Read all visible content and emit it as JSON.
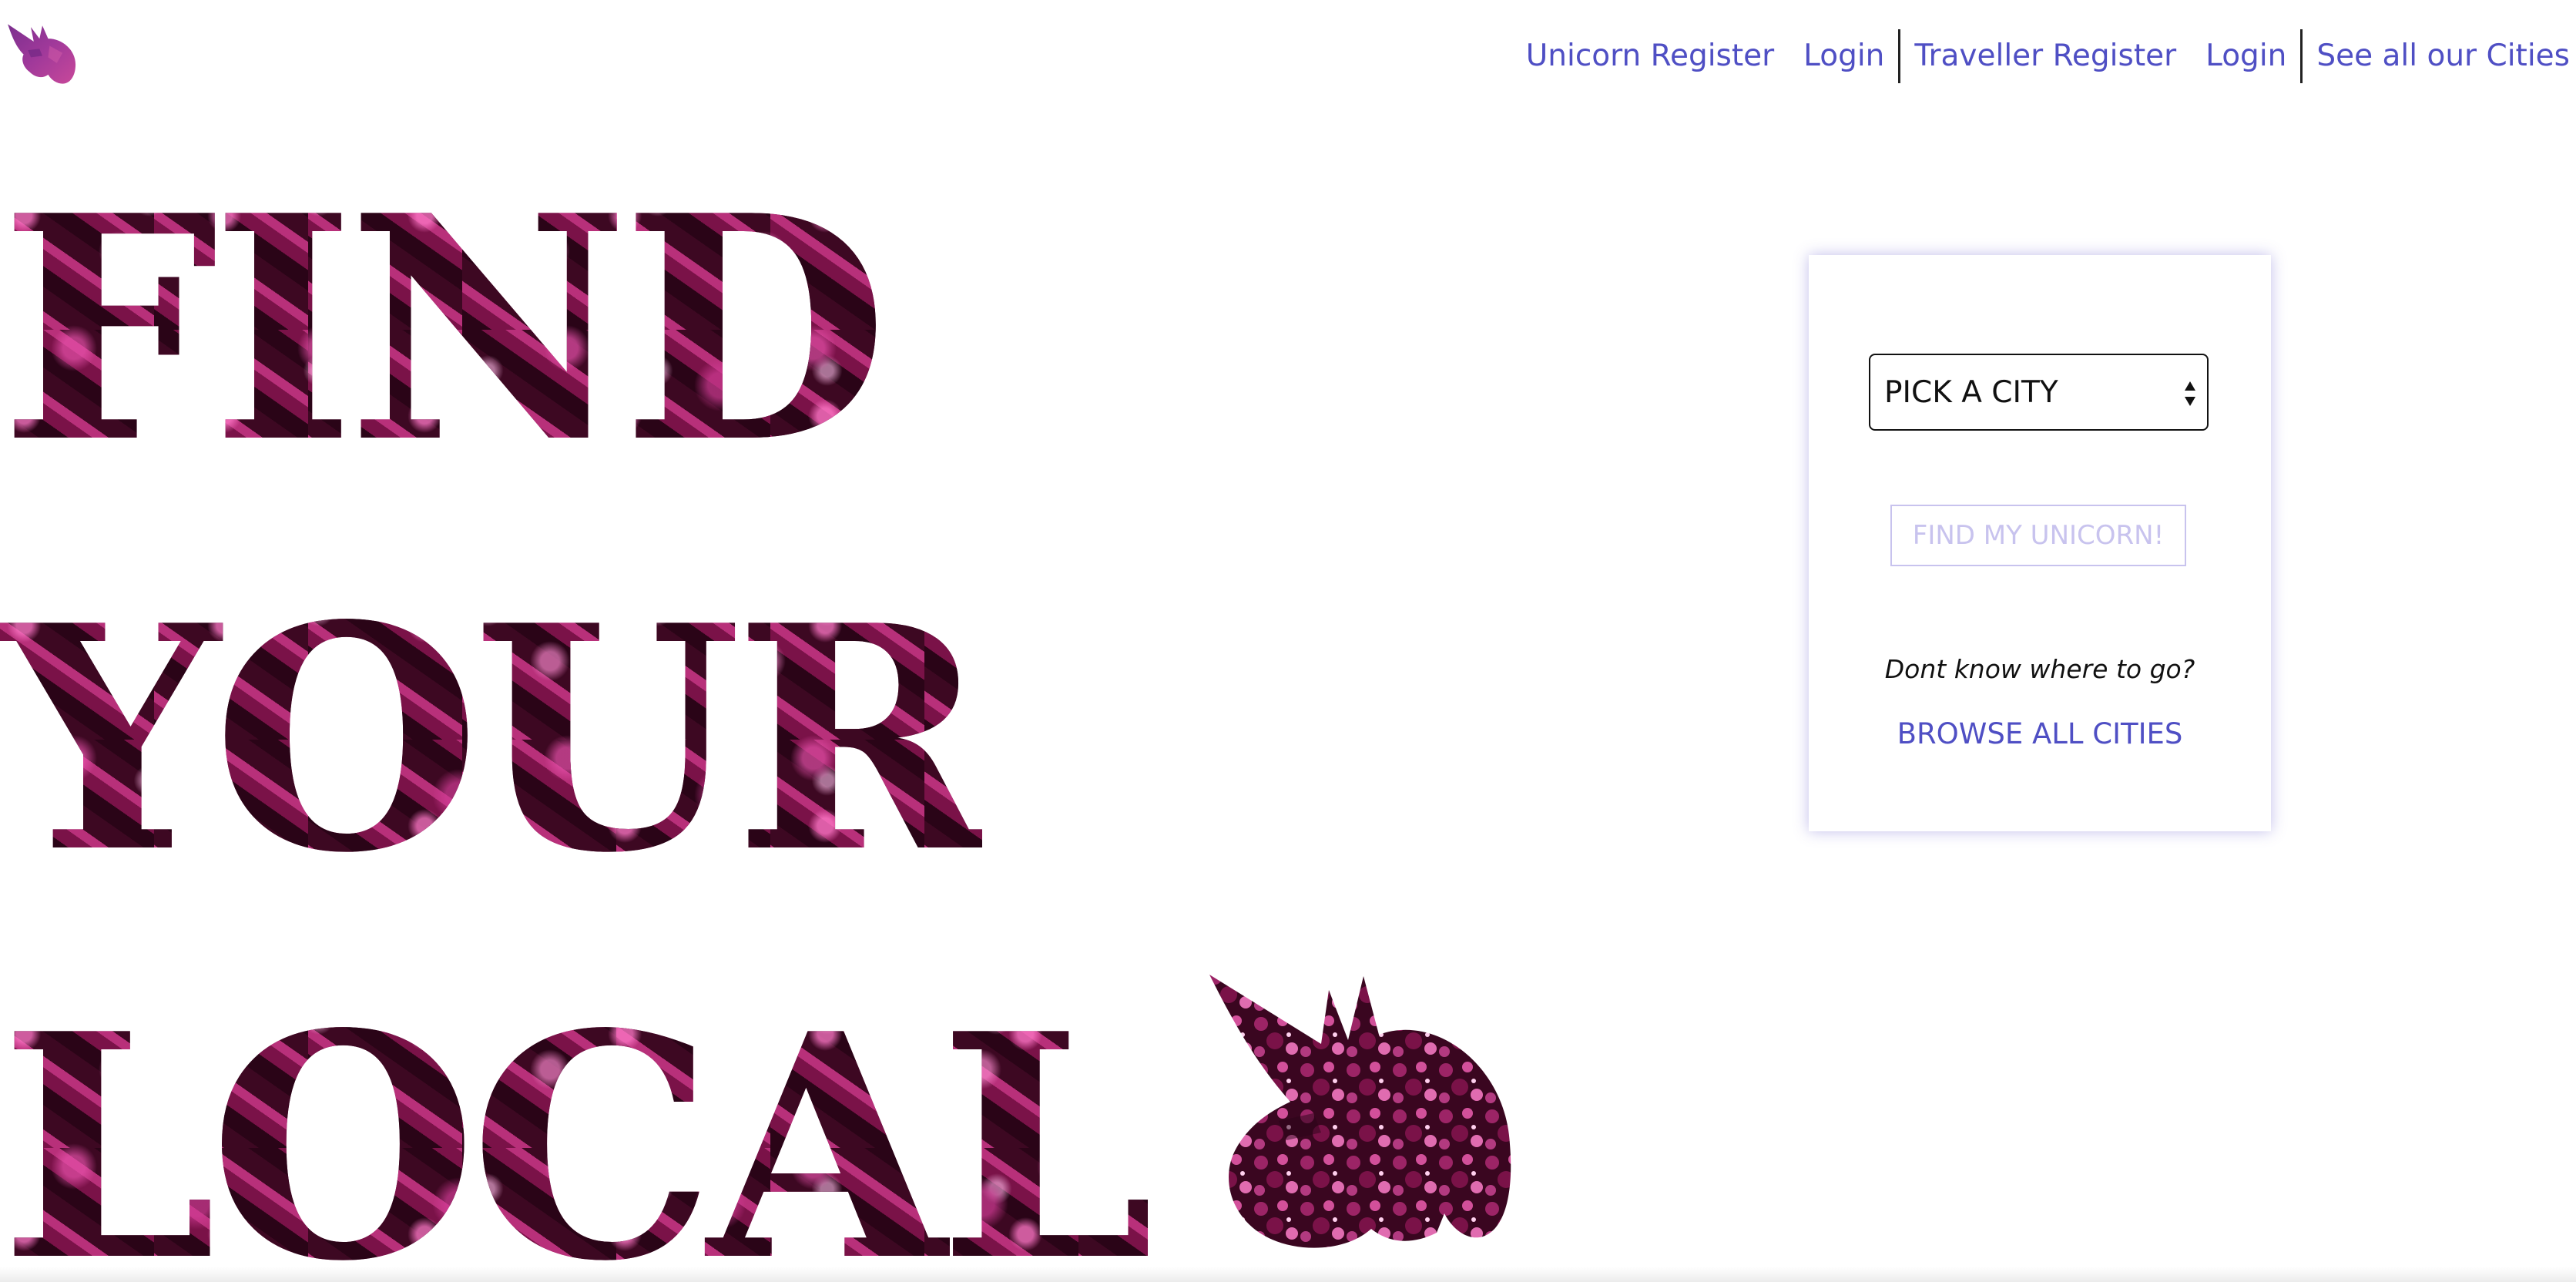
{
  "header": {
    "logo_icon": "unicorn-head-icon",
    "nav": {
      "unicorn_register": "Unicorn Register",
      "unicorn_login": "Login",
      "traveller_register": "Traveller Register",
      "traveller_login": "Login",
      "see_all_cities": "See all our Cities"
    },
    "link_color": "#4f4fc4"
  },
  "hero": {
    "line1": "FIND",
    "line2": "YOUR",
    "line3": "LOCAL",
    "icon": "unicorn-head-icon",
    "text_texture_colors": [
      "#3a0620",
      "#8e1a56",
      "#b8307a",
      "#ff78c8"
    ]
  },
  "search_card": {
    "city_select": {
      "selected": "PICK A CITY",
      "icon": "select-arrows-icon"
    },
    "find_button": "FIND MY UNICORN!",
    "help_text": "Dont know where to go?",
    "browse_link": "BROWSE ALL CITIES",
    "button_color": "#c8c3ee"
  }
}
